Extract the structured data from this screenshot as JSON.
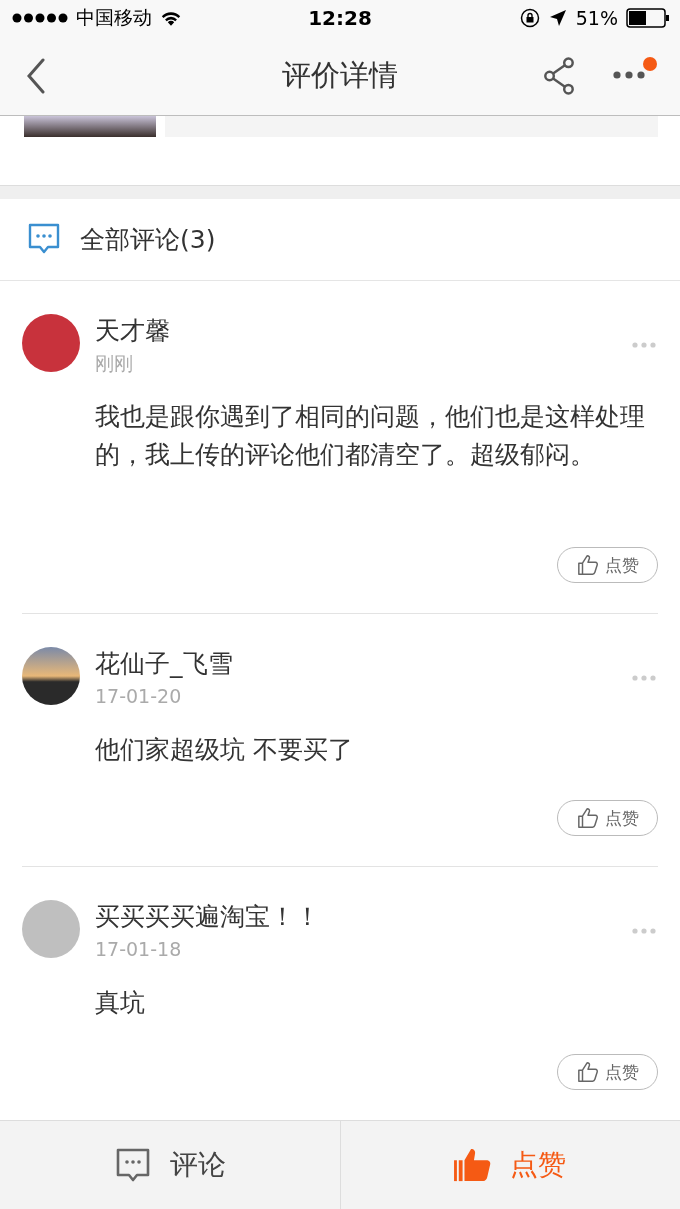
{
  "status_bar": {
    "carrier": "中国移动",
    "time": "12:28",
    "battery": "51%"
  },
  "nav": {
    "title": "评价详情",
    "has_notification": true
  },
  "comments_header": {
    "title": "全部评论(3)"
  },
  "comments": [
    {
      "name": "天才馨",
      "time": "刚刚",
      "text": "我也是跟你遇到了相同的问题，他们也是这样处理的，我上传的评论他们都清空了。超级郁闷。",
      "like_label": "点赞"
    },
    {
      "name": "花仙子_飞雪",
      "time": "17-01-20",
      "text": "他们家超级坑 不要买了",
      "like_label": "点赞"
    },
    {
      "name": "买买买买遍淘宝！！",
      "time": "17-01-18",
      "text": "真坑",
      "like_label": "点赞"
    }
  ],
  "bottom_bar": {
    "comment_label": "评论",
    "like_label": "点赞"
  }
}
